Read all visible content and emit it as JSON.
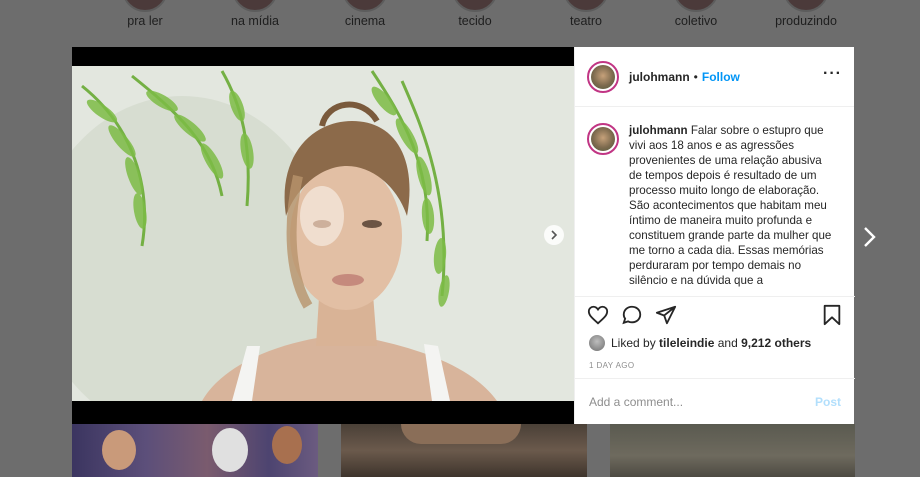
{
  "highlights": [
    {
      "label": "pra ler"
    },
    {
      "label": "na mídia"
    },
    {
      "label": "cinema"
    },
    {
      "label": "tecido"
    },
    {
      "label": "teatro"
    },
    {
      "label": "coletivo"
    },
    {
      "label": "produzindo"
    }
  ],
  "post": {
    "username": "julohmann",
    "separator": "•",
    "follow_label": "Follow",
    "more_icon": "more-options-icon",
    "caption": "Falar sobre o estupro que vivi aos 18 anos e as agressões provenientes de uma relação abusiva de tempos depois é resultado de um processo muito longo de elaboração. São acontecimentos que habitam meu íntimo de maneira muito profunda e constituem grande parte da mulher que me torno a cada dia. Essas memórias perduraram por tempo demais no silêncio e na dúvida que a",
    "liked_prefix": "Liked by",
    "liked_user": "tileleindie",
    "liked_and": "and",
    "liked_others": "9,212 others",
    "time": "1 DAY AGO",
    "comment_placeholder": "Add a comment...",
    "post_label": "Post"
  },
  "colors": {
    "follow": "#0095f6",
    "post_disabled": "#b2dffc",
    "overlay_bg": "#6d6d6d"
  }
}
